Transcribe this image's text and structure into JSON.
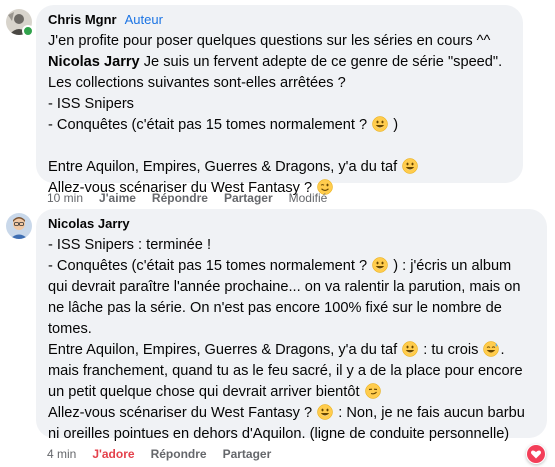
{
  "comment1": {
    "author": "Chris Mgnr",
    "badge": "Auteur",
    "line1": "J'en profite pour poser quelques questions sur les séries en cours ^^",
    "line2_bold": "Nicolas Jarry",
    "line2_rest": " Je suis un fervent adepte de ce genre de série \"speed\".",
    "line3": "Les collections suivantes sont-elles arrêtées ?",
    "line4": "- ISS Snipers",
    "line5a": "- Conquêtes (c'était pas 15 tomes normalement ? ",
    "line5b": " )",
    "line7": "Entre Aquilon, Empires, Guerres & Dragons, y'a du taf ",
    "line8": "Allez-vous scénariser du West Fantasy ? ",
    "time": "10 min",
    "like": "J'aime",
    "reply": "Répondre",
    "share": "Partager",
    "edited": "Modifié"
  },
  "comment2": {
    "author": "Nicolas Jarry",
    "l1": "- ISS Snipers : terminée !",
    "l2a": "- Conquêtes (c'était pas 15 tomes normalement ? ",
    "l2b": " ) : j'écris un album",
    "l3": "qui devrait paraître l'année prochaine... on va ralentir la parution, mais on",
    "l4": "ne lâche pas la série. On n'est pas encore 100% fixé sur le nombre de",
    "l5": "tomes.",
    "l6a": "Entre Aquilon, Empires, Guerres & Dragons, y'a du taf ",
    "l6b": " : tu crois ",
    "l6c": ".",
    "l7": "mais franchement, quand tu as le feu sacré, il y a de la place pour encore",
    "l8a": "un petit quelque chose qui devrait arriver bientôt ",
    "l9a": "Allez-vous scénariser du West Fantasy ? ",
    "l9b": " : Non, je ne fais aucun barbu",
    "l10": "ni oreilles pointues en dehors d'Aquilon. (ligne de conduite personnelle)",
    "time": "4 min",
    "like": "J'adore",
    "reply": "Répondre",
    "share": "Partager"
  },
  "colors": {
    "bubble": "#f0f2f5",
    "badge": "#1b74e4",
    "meta": "#65676b",
    "love": "#e4414b"
  }
}
